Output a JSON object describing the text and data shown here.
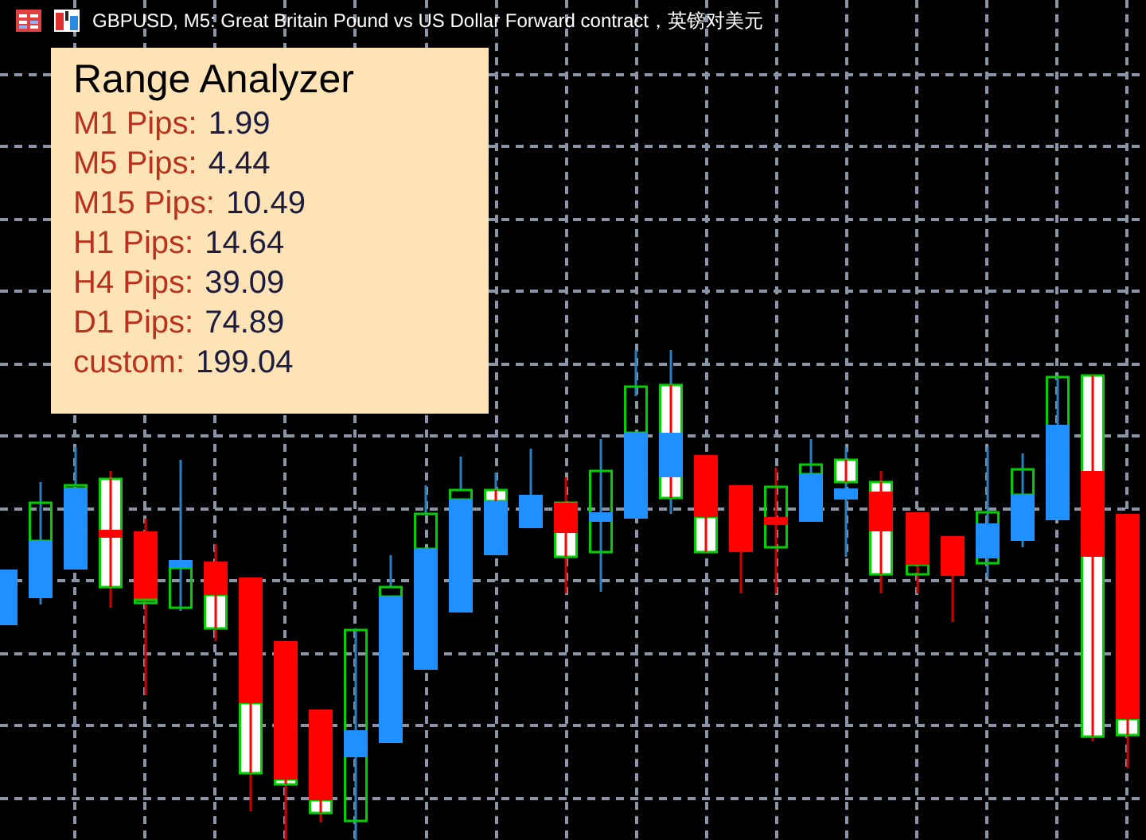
{
  "window": {
    "title": "GBPUSD, M5:  Great Britain Pound vs US Dollar Forward contract，英镑对美元"
  },
  "panel": {
    "title": "Range Analyzer",
    "rows": [
      {
        "label": "M1 Pips:",
        "value": "1.99"
      },
      {
        "label": "M5 Pips:",
        "value": "4.44"
      },
      {
        "label": "M15 Pips:",
        "value": "10.49"
      },
      {
        "label": "H1 Pips:",
        "value": "14.64"
      },
      {
        "label": "H4 Pips:",
        "value": "39.09"
      },
      {
        "label": "D1 Pips:",
        "value": "74.89"
      },
      {
        "label": "custom:",
        "value": "199.04"
      }
    ]
  }
}
